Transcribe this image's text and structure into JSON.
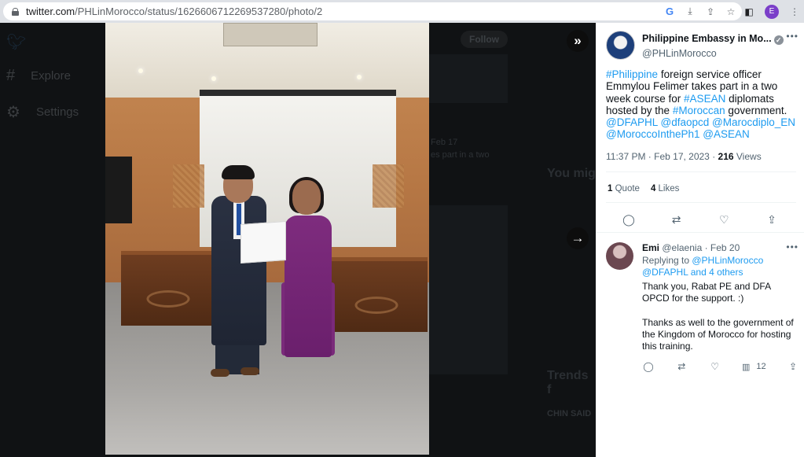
{
  "browser": {
    "url_host": "twitter.com",
    "url_path": "/PHLinMorocco/status/1626606712269537280/photo/2",
    "profile_initial": "E"
  },
  "background_page": {
    "nav_explore": "Explore",
    "nav_settings": "Settings",
    "follow_label": "Follow",
    "you_might_like": "You mig",
    "trends": "Trends f",
    "trend_item": "CHIN SAID",
    "partial_date": "Feb 17",
    "partial_text": "es part in a two"
  },
  "tweet": {
    "author_name": "Philippine Embassy in Mo...",
    "author_handle": "@PHLinMorocco",
    "text_segments": [
      {
        "text": "#Philippine",
        "link": true
      },
      {
        "text": " foreign service officer Emmylou Felimer takes part in a two week course for ",
        "link": false
      },
      {
        "text": "#ASEAN",
        "link": true
      },
      {
        "text": " diplomats hosted by the ",
        "link": false
      },
      {
        "text": "#Moroccan",
        "link": true
      },
      {
        "text": " government. ",
        "link": false
      },
      {
        "text": "@DFAPHL",
        "link": true
      },
      {
        "text": " ",
        "link": false
      },
      {
        "text": "@dfaopcd",
        "link": true
      },
      {
        "text": " ",
        "link": false
      },
      {
        "text": "@Marocdiplo_EN",
        "link": true
      },
      {
        "text": " ",
        "link": false
      },
      {
        "text": "@MoroccoInthePh1",
        "link": true
      },
      {
        "text": " ",
        "link": false
      },
      {
        "text": "@ASEAN",
        "link": true
      }
    ],
    "timestamp": "11:37 PM · Feb 17, 2023 · ",
    "views_count": "216",
    "views_label": " Views",
    "quote_count": "1",
    "quote_label": " Quote",
    "likes_count": "4",
    "likes_label": " Likes"
  },
  "reply": {
    "name": "Emi",
    "handle": "@elaenia",
    "date": " · Feb 20",
    "replying_prefix": "Replying to ",
    "replying_to": "@PHLinMorocco",
    "replying_others": "@DFAPHL and 4 others",
    "body_p1": "Thank you, Rabat PE and DFA OPCD for the support. :)",
    "body_p2": "Thanks as well to the government of the Kingdom of Morocco for hosting this training.",
    "views_count": "12"
  },
  "icons": [
    "lock-icon",
    "google-icon",
    "install-icon",
    "share-icon",
    "star-icon",
    "sidepanel-icon",
    "collapse-icon",
    "next-icon",
    "reply-icon",
    "retweet-icon",
    "like-icon",
    "share-tweet-icon",
    "views-icon",
    "verified-icon",
    "more-icon"
  ]
}
